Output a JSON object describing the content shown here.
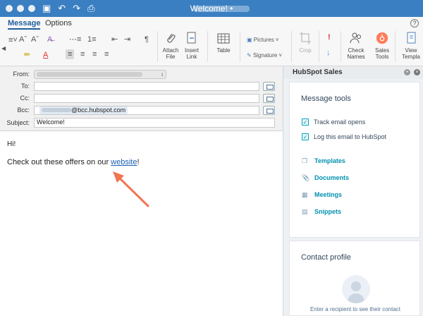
{
  "titlebar": {
    "title": "Welcome! •"
  },
  "ribbon": {
    "tabs": [
      "Message",
      "Options"
    ],
    "attach_file": "Attach\nFile",
    "insert_link": "Insert\nLink",
    "table": "Table",
    "pictures": "Pictures",
    "signature": "Signature",
    "crop": "Crop",
    "check_names": "Check\nNames",
    "sales_tools": "Sales\nTools",
    "view_templates": "View\nTempla"
  },
  "fields": {
    "from_label": "From:",
    "to_label": "To:",
    "cc_label": "Cc:",
    "bcc_label": "Bcc:",
    "bcc_value": "@bcc.hubspot.com",
    "subject_label": "Subject:",
    "subject_value": "Welcome!"
  },
  "body": {
    "greeting": "Hi!",
    "offer_text": "Check out these offers on our ",
    "link_text": "website",
    "offer_end": "!"
  },
  "panel": {
    "title": "HubSpot Sales",
    "tools_title": "Message tools",
    "checks": [
      "Track email opens",
      "Log this email to HubSpot"
    ],
    "tools": [
      "Templates",
      "Documents",
      "Meetings",
      "Snippets"
    ],
    "contact_title": "Contact profile",
    "contact_hint": "Enter a recipient to see their contact"
  },
  "colors": {
    "titlebar": "#3a7fc1",
    "accent_teal": "#00a4bd",
    "annotation_arrow": "#f07654",
    "hubspot_orange": "#ff7a59"
  }
}
